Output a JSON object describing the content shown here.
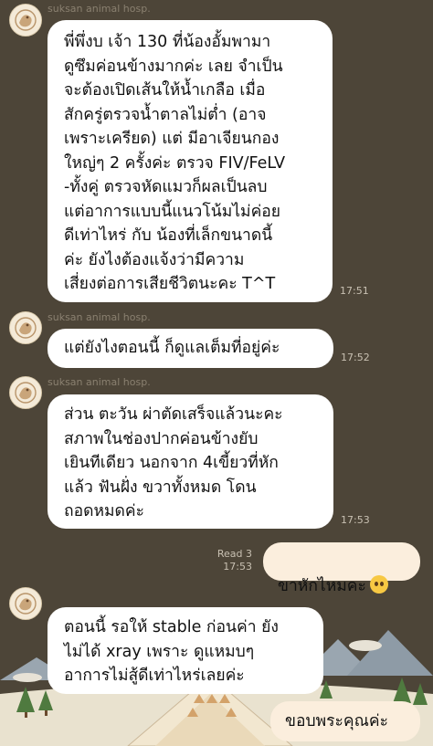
{
  "sender_name": "suksan animal hosp.",
  "messages": [
    {
      "from": "them",
      "text": "พี่พึ่งบ เจ้า 130 ที่น้องอั้มพามา\nดูซึมค่อนข้างมากค่ะ เลย จำเป็น\nจะต้องเปิดเส้นให้น้ำเกลือ เมื่อ\nสักครู่ตรวจน้ำตาลไม่ต่ำ (อาจ\nเพราะเครียด) แต่ มีอาเจียนกอง\nใหญ่ๆ 2 ครั้งค่ะ ตรวจ FIV/FeLV\n-ทั้งคู่ ตรวจหัดแมวก็ผลเป็นลบ\nแต่อาการแบบนี้แนวโน้มไม่ค่อย\nดีเท่าไหร่ กับ น้องที่เล็กขนาดนี้\nค่ะ ยังไงต้องแจ้งว่ามีความ\nเสี่ยงต่อการเสียชีวิตนะคะ T^T",
      "time": "17:51"
    },
    {
      "from": "them",
      "text": "แต่ยังไงตอนนี้ ก็ดูแลเต็มที่อยู่ค่ะ",
      "time": "17:52"
    },
    {
      "from": "them",
      "text": "ส่วน ตะวัน ผ่าตัดเสร็จแล้วนะคะ\nสภาพในช่องปากค่อนข้างยับ\nเยินทีเดียว นอกจาก 4เขี้ยวที่หัก\nแล้ว ฟันฝั่ง ขวาทั้งหมด โดน\nถอดหมดค่ะ",
      "time": "17:53"
    },
    {
      "from": "me",
      "text": "ขาหักไหมคะ",
      "read": "Read 3",
      "time": "17:53"
    },
    {
      "from": "them",
      "text": "ตอนนี้ รอให้ stable ก่อนค่า ยัง\nไม่ได้ xray เพราะ ดูแหมบๆ\nอาการไม่สู้ดีเท่าไหร่เลยค่ะ",
      "time": ""
    },
    {
      "from": "me",
      "text": "ขอบพระคุณค่ะ",
      "time": ""
    }
  ],
  "icons": {
    "avatar": "hospital-logo-avatar",
    "emoji": "pleading-face-emoji"
  },
  "colors": {
    "background": "#4d4538",
    "incoming_bubble": "#ffffff",
    "outgoing_bubble": "#fbeedd"
  }
}
